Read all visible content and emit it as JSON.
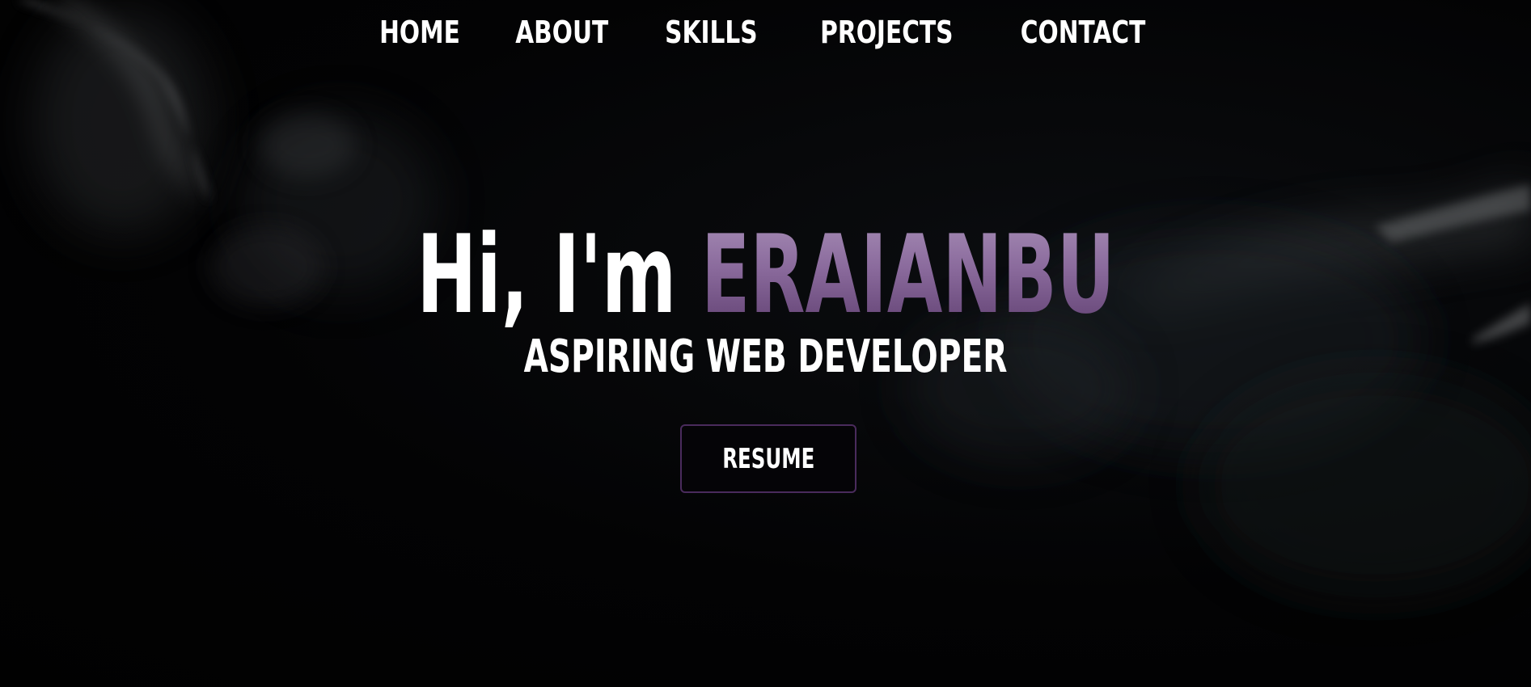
{
  "nav": {
    "items": [
      {
        "label": "HOME"
      },
      {
        "label": "ABOUT"
      },
      {
        "label": "SKILLS"
      },
      {
        "label": "PROJECTS"
      },
      {
        "label": "CONTACT"
      }
    ]
  },
  "hero": {
    "greeting": "Hi, I'm ",
    "name": "ERAIANBU",
    "subtitle": "ASPIRING WEB DEVELOPER",
    "resume_label": "RESUME"
  },
  "colors": {
    "background": "#020203",
    "name_gradient_top": "#a88fb7",
    "name_gradient_bottom": "#5d3d6e",
    "button_border": "#4a2b5c",
    "text": "#ffffff"
  }
}
